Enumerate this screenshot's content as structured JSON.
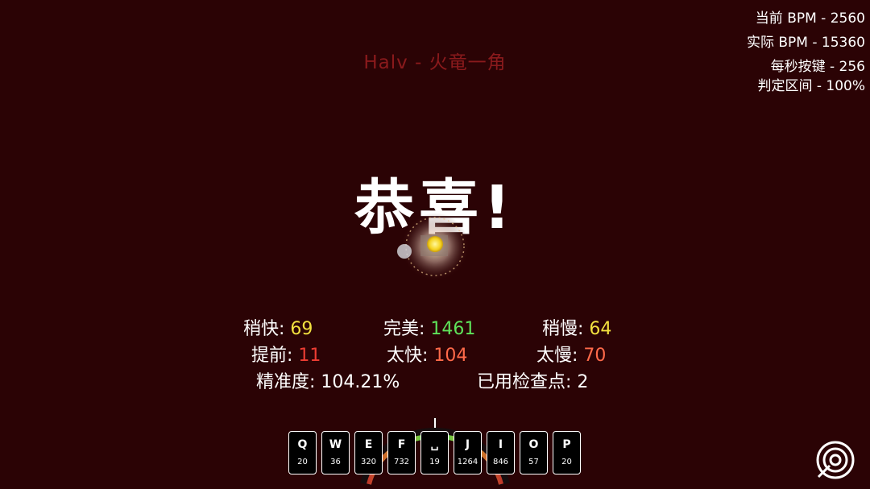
{
  "song": {
    "title": "Halv - 火竜一角"
  },
  "stats": {
    "current_bpm": "当前 BPM - 2560",
    "actual_bpm": "实际 BPM - 15360",
    "kps": "每秒按键 - 256",
    "judgement_window": "判定区间 - 100%"
  },
  "banner": {
    "text": "恭喜!"
  },
  "results": {
    "early_label": "稍快: ",
    "early_value": "69",
    "perfect_label": "完美: ",
    "perfect_value": "1461",
    "late_label": "稍慢: ",
    "late_value": "64",
    "too_early_label": "提前: ",
    "too_early_value": "11",
    "very_early_label": "太快: ",
    "very_early_value": "104",
    "very_late_label": "太慢: ",
    "very_late_value": "70",
    "accuracy": "精准度: 104.21%",
    "checkpoints": "已用检查点: 2"
  },
  "keys": [
    {
      "key": "Q",
      "count": "20"
    },
    {
      "key": "W",
      "count": "36"
    },
    {
      "key": "E",
      "count": "320"
    },
    {
      "key": "F",
      "count": "732"
    },
    {
      "key": "␣",
      "count": "19"
    },
    {
      "key": "J",
      "count": "1264"
    },
    {
      "key": "I",
      "count": "846"
    },
    {
      "key": "O",
      "count": "57"
    },
    {
      "key": "P",
      "count": "20"
    }
  ],
  "colors": {
    "background": "#2b0305",
    "title": "#8a1a1c",
    "early_late": "#f3e13f",
    "perfect": "#5ee35a",
    "miss": "#ee3d33"
  },
  "icons": {
    "settings_button": "target-icon"
  }
}
